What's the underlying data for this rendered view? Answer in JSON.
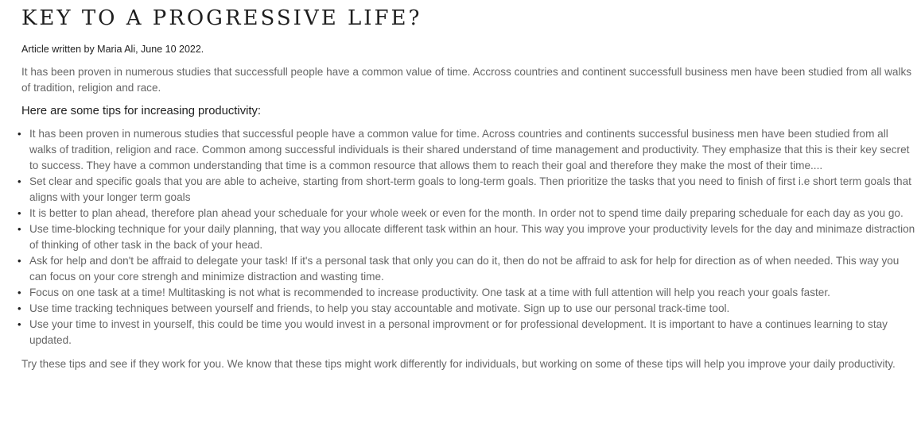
{
  "article": {
    "title": "KEY TO A PROGRESSIVE LIFE?",
    "byline": "Article written by Maria Ali, June 10 2022.",
    "intro": "It has been proven in numerous studies that successfull people have a common value of time. Accross countries and continent successfull business men have been studied from all walks of tradition, religion and race.",
    "tips_heading": "Here are some tips for increasing productivity:",
    "bullet_glyph": "•",
    "tips": [
      "It has been proven in numerous studies that successful people have a common value for time. Across countries and continents successful business men have been studied from all walks of tradition, religion and race. Common among successful individuals is their shared understand of time management and productivity. They emphasize that this is their key secret to success. They have a common understanding that time is a common resource that allows them to reach their goal and therefore they make the most of their time....",
      "Set clear and specific goals that you are able to acheive, starting from short-term goals to long-term goals. Then prioritize the tasks that you need to finish of first i.e short term goals that aligns with your longer term goals",
      "It is better to plan ahead, therefore plan ahead your scheduale for your whole week or even for the month. In order not to spend time daily preparing scheduale for each day as you go.",
      "Use time-blocking technique for your daily planning, that way you allocate different task within an hour. This way you improve your productivity levels for the day and minimaze distraction of thinking of other task in the back of your head.",
      "Ask for help and don't be affraid to delegate your task! If it's a personal task that only you can do it, then do not be affraid to ask for help for direction as of when needed. This way you can focus on your core strengh and minimize distraction and wasting time.",
      "Focus on one task at a time! Multitasking is not what is recommended to increase productivity. One task at a time with full attention will help you reach your goals faster.",
      "Use time tracking techniques between yourself and friends, to help you stay accountable and motivate. Sign up to use our personal track-time tool.",
      "Use your time to invest in yourself, this could be time you would invest in a personal improvment or for professional development. It is important to have a continues learning to stay updated."
    ],
    "outro": "Try these tips and see if they work for you. We know that these tips might work differently for individuals, but working on some of these tips will help you improve your daily productivity."
  },
  "colors": {
    "heading": "#1e1e1e",
    "body_text": "#666666",
    "background": "#ffffff"
  }
}
